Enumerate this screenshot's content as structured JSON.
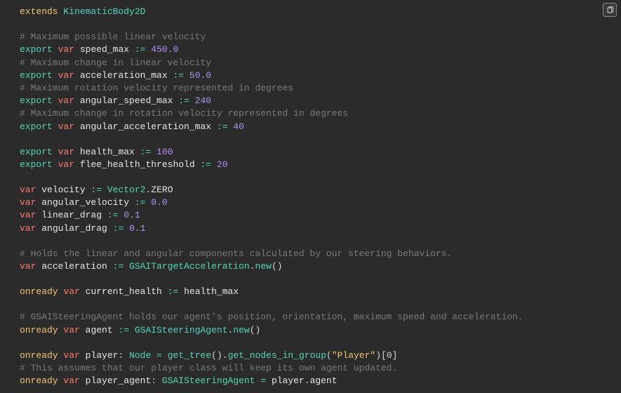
{
  "line1": {
    "extends": "extends",
    "class": "KinematicBody2D"
  },
  "c1": "# Maximum possible linear velocity",
  "l2": {
    "export": "export",
    "var": "var",
    "name": "speed_max",
    "op": ":=",
    "val": "450.0"
  },
  "c2": "# Maximum change in linear velocity",
  "l3": {
    "export": "export",
    "var": "var",
    "name": "acceleration_max",
    "op": ":=",
    "val": "50.0"
  },
  "c3": "# Maximum rotation velocity represented in degrees",
  "l4": {
    "export": "export",
    "var": "var",
    "name": "angular_speed_max",
    "op": ":=",
    "val": "240"
  },
  "c4": "# Maximum change in rotation velocity represented in degrees",
  "l5": {
    "export": "export",
    "var": "var",
    "name": "angular_acceleration_max",
    "op": ":=",
    "val": "40"
  },
  "l6": {
    "export": "export",
    "var": "var",
    "name": "health_max",
    "op": ":=",
    "val": "100"
  },
  "l7": {
    "export": "export",
    "var": "var",
    "name": "flee_health_threshold",
    "op": ":=",
    "val": "20"
  },
  "l8": {
    "var": "var",
    "name": "velocity",
    "op": ":=",
    "type": "Vector2",
    "dot": ".",
    "member": "ZERO"
  },
  "l9": {
    "var": "var",
    "name": "angular_velocity",
    "op": ":=",
    "val": "0.0"
  },
  "l10": {
    "var": "var",
    "name": "linear_drag",
    "op": ":=",
    "val": "0.1"
  },
  "l11": {
    "var": "var",
    "name": "angular_drag",
    "op": ":=",
    "val": "0.1"
  },
  "c5": "# Holds the linear and angular components calculated by our steering behaviors.",
  "l12": {
    "var": "var",
    "name": "acceleration",
    "op": ":=",
    "type": "GSAITargetAcceleration",
    "dot": ".",
    "fn": "new",
    "paren": "()"
  },
  "l13": {
    "onready": "onready",
    "var": "var",
    "name": "current_health",
    "op": ":=",
    "val": "health_max"
  },
  "c6": "# GSAISteeringAgent holds our agent's position, orientation, maximum speed and acceleration.",
  "l14": {
    "onready": "onready",
    "var": "var",
    "name": "agent",
    "op": ":=",
    "type": "GSAISteeringAgent",
    "dot": ".",
    "fn": "new",
    "paren": "()"
  },
  "l15": {
    "onready": "onready",
    "var": "var",
    "name": "player",
    "colon": ":",
    "type": "Node",
    "eq": "=",
    "fn1": "get_tree",
    "p1": "()",
    "dot1": ".",
    "fn2": "get_nodes_in_group",
    "p2o": "(",
    "str": "\"Player\"",
    "p2c": ")",
    "idx": "[0]"
  },
  "c7": "# This assumes that our player class will keep its own agent updated.",
  "l16": {
    "onready": "onready",
    "var": "var",
    "name": "player_agent",
    "colon": ":",
    "type": "GSAISteeringAgent",
    "eq": "=",
    "obj": "player",
    "dot": ".",
    "member": "agent"
  }
}
